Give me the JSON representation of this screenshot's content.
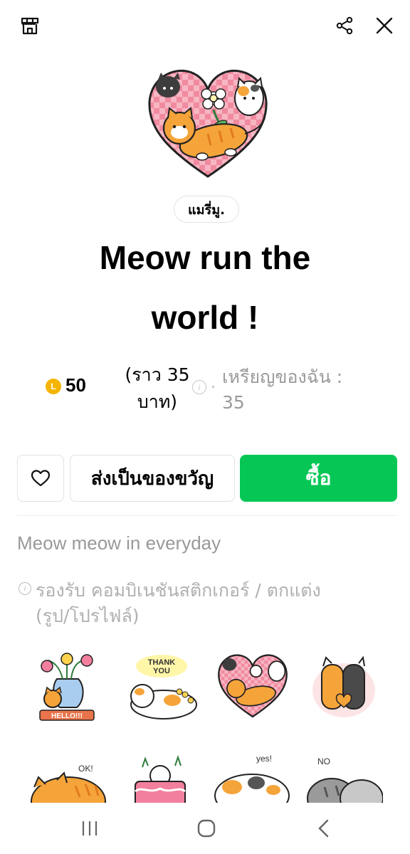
{
  "header": {
    "icons": [
      "shop-icon",
      "share-icon",
      "close-icon"
    ]
  },
  "product": {
    "author": "แมรี่มู.",
    "title_line1": "Meow run the",
    "title_line2": "world !",
    "price_coins": "50",
    "coin_badge": "L",
    "approx_line1": "(ราว 35",
    "approx_line2": "บาท)",
    "info_glyph": "i",
    "my_coins_line1": "เหรียญของฉัน :",
    "my_coins_line2": "35"
  },
  "actions": {
    "gift_label": "ส่งเป็นของขวัญ",
    "buy_label": "ซื้อ"
  },
  "details": {
    "description": "Meow meow in everyday",
    "support_line1": "รองรับ คอมบิเนชันสติกเกอร์ / ตกแต่ง",
    "support_line2": "(รูป/โปรไฟล์)"
  },
  "stickers": {
    "texts": [
      "HELLO!!!",
      "THANK",
      "YOU",
      "OK!",
      "yes!",
      "NO"
    ]
  },
  "colors": {
    "accent_green": "#06c755",
    "coin_gold": "#f5b400",
    "heart_pink": "#f08aa0",
    "cat_orange": "#f5a43a"
  },
  "navbar": {
    "icons": [
      "recent-apps-icon",
      "home-icon",
      "back-icon"
    ]
  }
}
